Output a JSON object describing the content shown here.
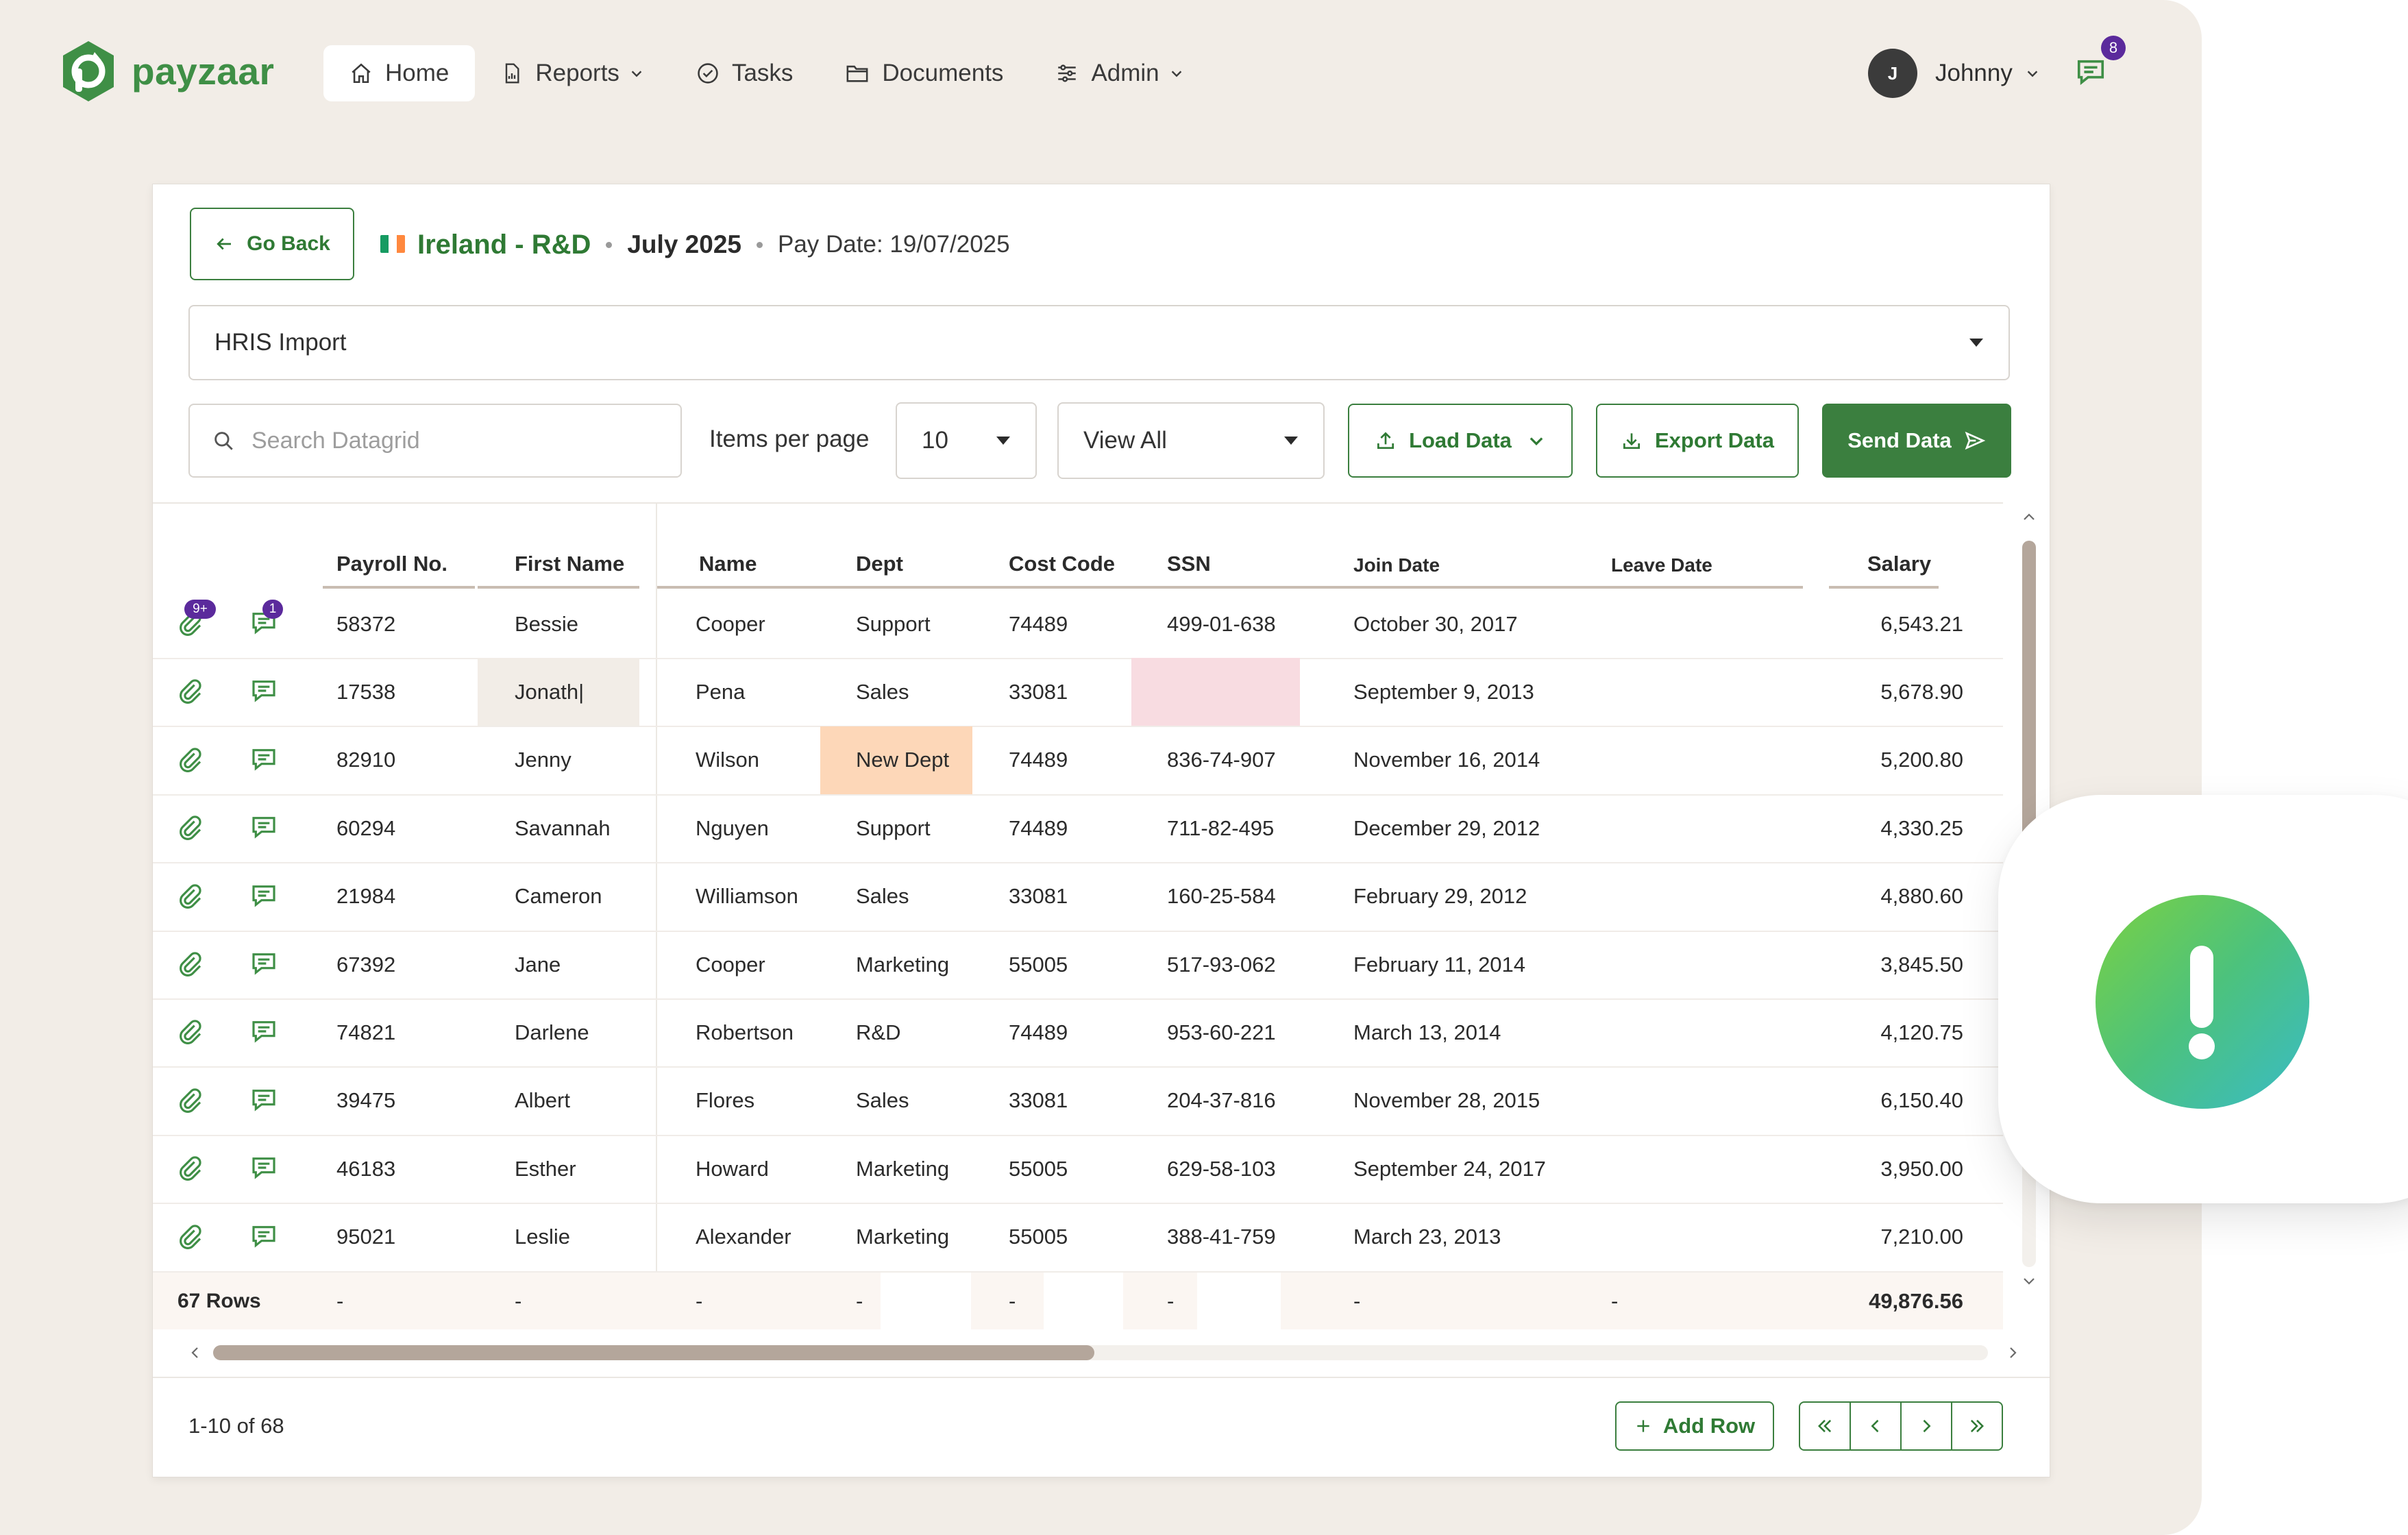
{
  "app": {
    "brand": "payzaar",
    "brand_color": "#3f8f46",
    "accent": "#3b7f3f"
  },
  "nav": {
    "items": [
      {
        "label": "Home",
        "icon": "home-icon",
        "active": true,
        "dropdown": false
      },
      {
        "label": "Reports",
        "icon": "report-icon",
        "active": false,
        "dropdown": true
      },
      {
        "label": "Tasks",
        "icon": "check-circle-icon",
        "active": false,
        "dropdown": false
      },
      {
        "label": "Documents",
        "icon": "folder-icon",
        "active": false,
        "dropdown": false
      },
      {
        "label": "Admin",
        "icon": "sliders-icon",
        "active": false,
        "dropdown": true
      }
    ]
  },
  "user": {
    "initial": "J",
    "name": "Johnny",
    "notifications": "8"
  },
  "header": {
    "back_label": "Go Back",
    "country": "Ireland - R&D",
    "period": "July 2025",
    "pay_date": "Pay Date: 19/07/2025"
  },
  "source": {
    "selected": "HRIS Import"
  },
  "toolbar": {
    "search_placeholder": "Search Datagrid",
    "items_per_page_label": "Items per page",
    "items_per_page_value": "10",
    "view_value": "View All",
    "load_label": "Load Data",
    "export_label": "Export Data",
    "send_label": "Send Data"
  },
  "table": {
    "columns": [
      "Payroll No.",
      "First Name",
      "Name",
      "Dept",
      "Cost Code",
      "SSN",
      "Join Date",
      "Leave Date",
      "Salary"
    ],
    "rows": [
      [
        "58372",
        "Bessie",
        "Cooper",
        "Support",
        "74489",
        "499-01-638",
        "October 30, 2017",
        "",
        "6,543.21"
      ],
      [
        "17538",
        "Jonath|",
        "Pena",
        "Sales",
        "33081",
        "",
        "September 9, 2013",
        "",
        "5,678.90"
      ],
      [
        "82910",
        "Jenny",
        "Wilson",
        "New Dept",
        "74489",
        "836-74-907",
        "November 16, 2014",
        "",
        "5,200.80"
      ],
      [
        "60294",
        "Savannah",
        "Nguyen",
        "Support",
        "74489",
        "711-82-495",
        "December 29, 2012",
        "",
        "4,330.25"
      ],
      [
        "21984",
        "Cameron",
        "Williamson",
        "Sales",
        "33081",
        "160-25-584",
        "February 29, 2012",
        "",
        "4,880.60"
      ],
      [
        "67392",
        "Jane",
        "Cooper",
        "Marketing",
        "55005",
        "517-93-062",
        "February 11, 2014",
        "",
        "3,845.50"
      ],
      [
        "74821",
        "Darlene",
        "Robertson",
        "R&D",
        "74489",
        "953-60-221",
        "March 13, 2014",
        "",
        "4,120.75"
      ],
      [
        "39475",
        "Albert",
        "Flores",
        "Sales",
        "33081",
        "204-37-816",
        "November 28, 2015",
        "",
        "6,150.40"
      ],
      [
        "46183",
        "Esther",
        "Howard",
        "Marketing",
        "55005",
        "629-58-103",
        "September 24, 2017",
        "",
        "3,950.00"
      ],
      [
        "95021",
        "Leslie",
        "Alexander",
        "Marketing",
        "55005",
        "388-41-759",
        "March 23, 2013",
        "",
        "7,210.00"
      ]
    ],
    "row_badges": {
      "attachments": "9+",
      "comments": "1"
    },
    "footer": {
      "rows_label": "67 Rows",
      "placeholder": "-",
      "salary_total": "49,876.56"
    }
  },
  "pagination": {
    "range": "1-10 of 68",
    "add_row_label": "Add Row"
  },
  "highlight_colors": {
    "editing": "#f2ede7",
    "error": "#f8dce1",
    "warning": "#fdd7b8"
  }
}
